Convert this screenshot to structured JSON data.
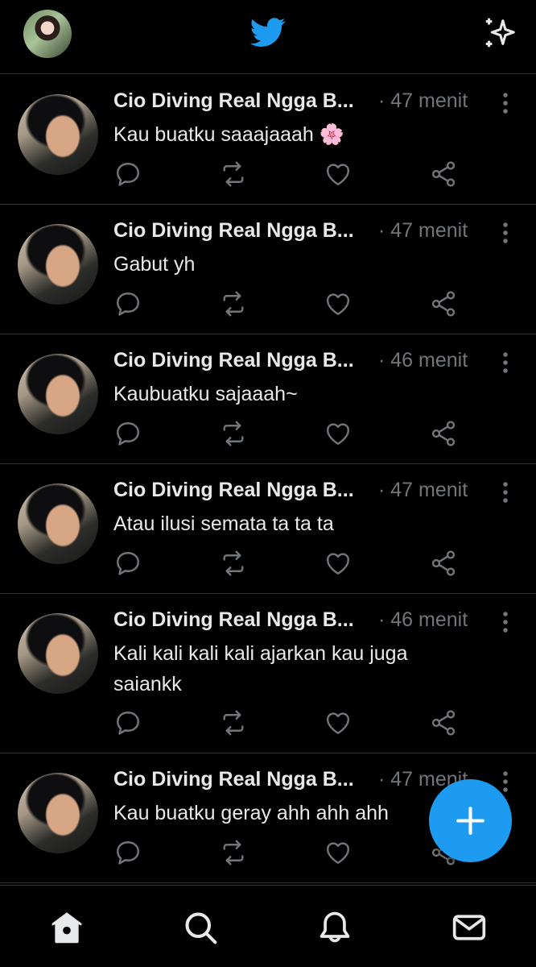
{
  "header": {
    "avatar_icon": "profile-avatar",
    "logo_icon": "twitter-bird-icon",
    "sparkle_icon": "sparkle-icon"
  },
  "tweets": [
    {
      "name": "Cio Diving Real Ngga B...",
      "time": "· 47 menit",
      "text": "Kau buatku saaajaaah 🌸"
    },
    {
      "name": "Cio Diving Real Ngga B...",
      "time": "· 47 menit",
      "text": "Gabut yh"
    },
    {
      "name": "Cio Diving Real Ngga B...",
      "time": "· 46 menit",
      "text": "Kaubuatku sajaaah~"
    },
    {
      "name": "Cio Diving Real Ngga B...",
      "time": "· 47 menit",
      "text": "Atau ilusi semata ta ta ta"
    },
    {
      "name": "Cio Diving Real Ngga B...",
      "time": "· 46 menit",
      "text": "Kali kali kali kali ajarkan kau juga saiankk"
    },
    {
      "name": "Cio Diving Real Ngga B...",
      "time": "· 47 menit",
      "text": "Kau buatku geray ahh ahh ahh"
    }
  ],
  "fab": {
    "icon": "plus-icon"
  },
  "tabs": [
    {
      "icon": "home-icon"
    },
    {
      "icon": "search-icon"
    },
    {
      "icon": "notifications-icon"
    },
    {
      "icon": "messages-icon"
    }
  ],
  "colors": {
    "accent": "#1d9bf0",
    "background": "#000000",
    "text": "#e7e9ea",
    "muted": "#71767b",
    "divider": "#2f3336"
  }
}
